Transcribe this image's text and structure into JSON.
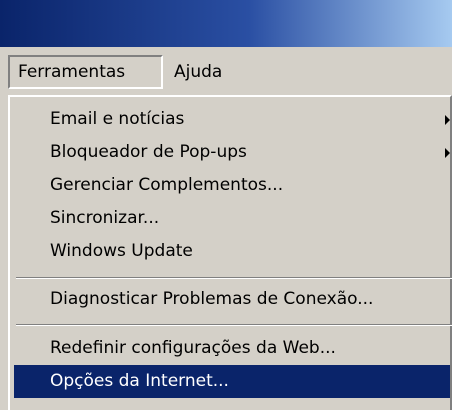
{
  "menubar": {
    "items": [
      {
        "label": "Ferramentas"
      },
      {
        "label": "Ajuda"
      }
    ]
  },
  "dropdown": {
    "items": [
      {
        "label": "Email e notícias",
        "submenu": true
      },
      {
        "label": "Bloqueador de Pop-ups",
        "submenu": true
      },
      {
        "label": "Gerenciar Complementos..."
      },
      {
        "label": "Sincronizar..."
      },
      {
        "label": "Windows Update"
      },
      {
        "label": "Diagnosticar Problemas de Conexão..."
      },
      {
        "label": "Redefinir configurações da Web..."
      },
      {
        "label": "Opções da Internet...",
        "highlighted": true
      }
    ]
  },
  "colors": {
    "menu_background": "#d4d0c8",
    "highlight": "#0a246a",
    "titlebar_start": "#0a246a",
    "titlebar_end": "#a6caf0"
  },
  "icons": {
    "submenu_arrow": "submenu-arrow-icon"
  }
}
